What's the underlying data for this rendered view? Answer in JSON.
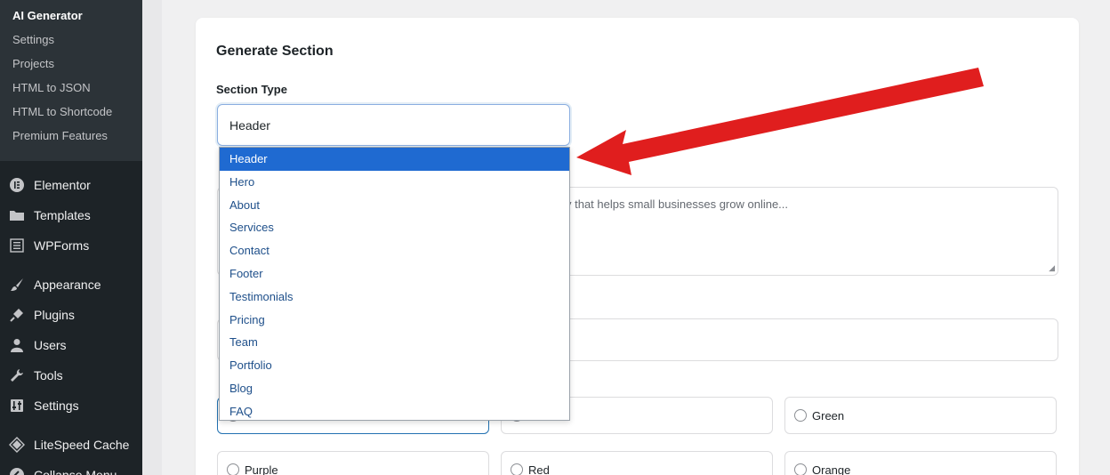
{
  "sidebar": {
    "submenu": [
      {
        "label": "AI Generator",
        "current": true
      },
      {
        "label": "Settings"
      },
      {
        "label": "Projects"
      },
      {
        "label": "HTML to JSON"
      },
      {
        "label": "HTML to Shortcode"
      },
      {
        "label": "Premium Features"
      }
    ],
    "menu": [
      {
        "label": "Elementor",
        "icon": "elementor-icon"
      },
      {
        "label": "Templates",
        "icon": "folder-icon"
      },
      {
        "label": "WPForms",
        "icon": "forms-icon"
      },
      {
        "label": "Appearance",
        "icon": "brush-icon"
      },
      {
        "label": "Plugins",
        "icon": "plug-icon"
      },
      {
        "label": "Users",
        "icon": "user-icon"
      },
      {
        "label": "Tools",
        "icon": "wrench-icon"
      },
      {
        "label": "Settings",
        "icon": "settings-icon"
      },
      {
        "label": "LiteSpeed Cache",
        "icon": "diamond-icon"
      },
      {
        "label": "Collapse Menu",
        "icon": "collapse-icon"
      }
    ]
  },
  "main": {
    "title": "Generate Section",
    "section_type_label": "Section Type",
    "section_type_value": "Header",
    "textarea_placeholder_visible": "y that helps small businesses grow online...",
    "dropdown_options": [
      "Header",
      "Hero",
      "About",
      "Services",
      "Contact",
      "Footer",
      "Testimonials",
      "Pricing",
      "Team",
      "Portfolio",
      "Blog",
      "FAQ"
    ],
    "dropdown_selected": "Header",
    "color_options_visible": [
      "Green",
      "Purple",
      "Red",
      "Orange"
    ]
  },
  "colors": {
    "sidebar_bg": "#1d2327",
    "submenu_bg": "#2c3338",
    "accent": "#1f6ad1",
    "arrow": "#e01e1e"
  }
}
